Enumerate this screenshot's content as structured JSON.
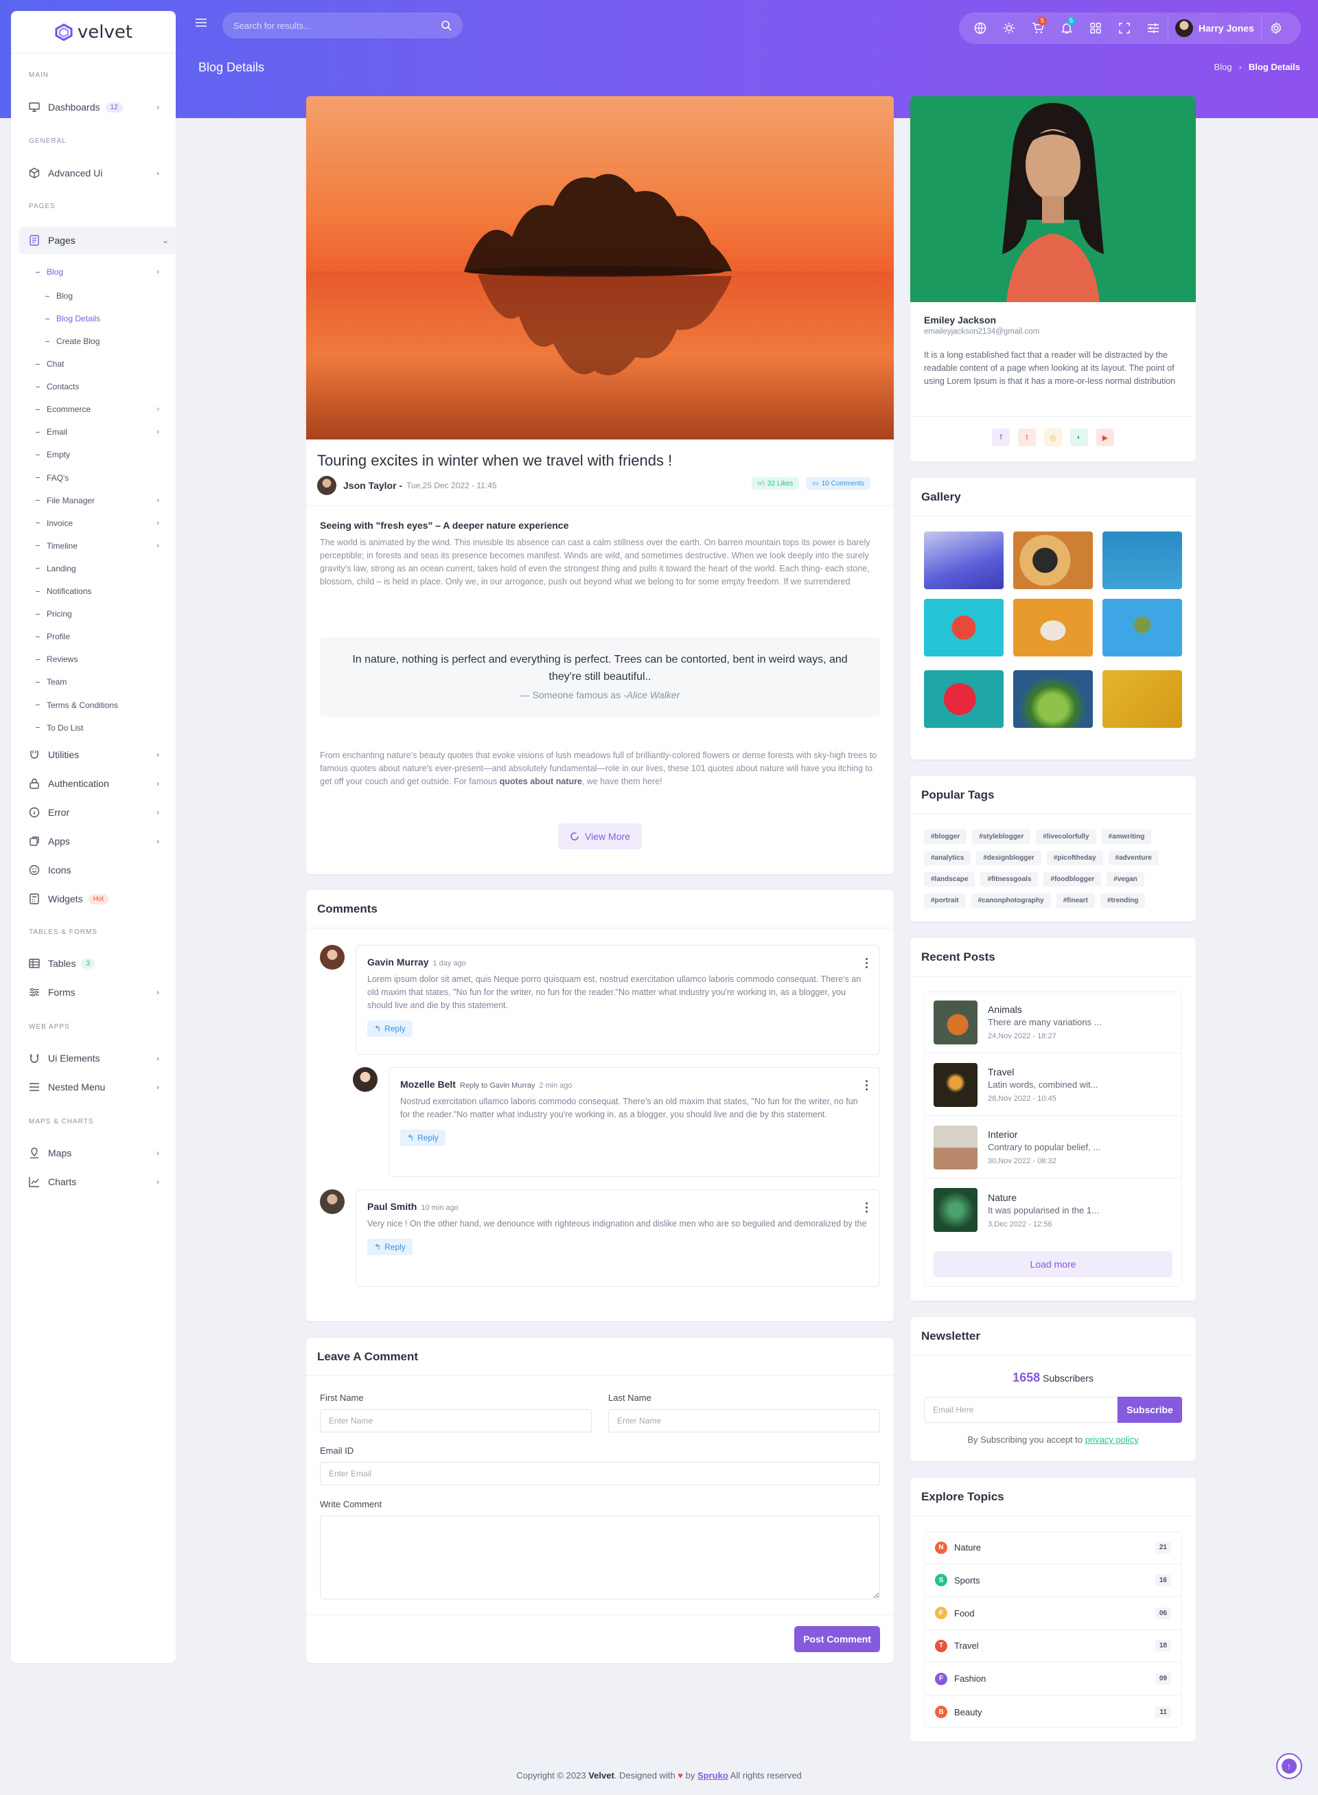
{
  "app": {
    "name": "velvet"
  },
  "topbar": {
    "search_placeholder": "Search for results...",
    "cart_count": "5",
    "notif_count": "5",
    "user_name": "Harry Jones"
  },
  "page": {
    "title": "Blog Details",
    "breadcrumb": [
      "Blog",
      "Blog Details"
    ]
  },
  "sidebar": {
    "cats": [
      "MAIN",
      "GENERAL",
      "PAGES",
      "TABLES & FORMS",
      "WEB APPS",
      "MAPS & CHARTS"
    ],
    "dashboards": {
      "label": "Dashboards",
      "badge": "12"
    },
    "advanced_ui": "Advanced Ui",
    "pages": "Pages",
    "blog": "Blog",
    "blog_sub": [
      "Blog",
      "Blog Details",
      "Create Blog"
    ],
    "pages_sub": [
      "Chat",
      "Contacts",
      "Ecommerce",
      "Email",
      "Empty",
      "FAQ's",
      "File Manager",
      "Invoice",
      "Timeline",
      "Landing",
      "Notifications",
      "Pricing",
      "Profile",
      "Reviews",
      "Team",
      "Terms & Conditions",
      "To Do List"
    ],
    "utilities": "Utilities",
    "authentication": "Authentication",
    "error": "Error",
    "apps": "Apps",
    "icons": "Icons",
    "widgets": {
      "label": "Widgets",
      "badge": "Hot"
    },
    "tables": {
      "label": "Tables",
      "badge": "3"
    },
    "forms": "Forms",
    "ui_elements": "Ui Elements",
    "nested_menu": "Nested Menu",
    "maps": "Maps",
    "charts": "Charts"
  },
  "post": {
    "title": "Touring excites in winter when we travel with friends !",
    "author": "Json Taylor -",
    "date": "Tue,25 Dec 2022 - 11:45",
    "likes": "32 Likes",
    "comments": "10 Comments",
    "subheading": "Seeing with \"fresh eyes\" – A deeper nature experience",
    "body1": "The world is animated by the wind. This invisible its absence can cast a calm stillness over the earth. On barren mountain tops its power is barely perceptible; in forests and seas its presence becomes manifest. Winds are wild, and sometimes destructive. When we look deeply into the surely gravity's law, strong as an ocean current, takes hold of even the strongest thing and pulls it toward the heart of the world. Each thing- each stone, blossom, child – is held in place. Only we, in our arrogance, push out beyond what we belong to for some empty freedom. If we surrendered",
    "quote": "In nature, nothing is perfect and everything is perfect. Trees can be contorted, bent in weird ways, and they're still beautiful..",
    "quote_source_prefix": "— Someone famous as",
    "quote_source": "-Alice Walker",
    "body2_a": "From enchanting nature's beauty quotes that evoke visions of lush meadows full of brilliantly-colored flowers or dense forests with sky-high trees to famous quotes about nature's ever-present—and absolutely fundamental—role in our lives, these 101 quotes about nature will have you itching to get off your couch and get outside. For famous",
    "body2_bold": "quotes about nature",
    "body2_b": ", we have them here!",
    "view_more": "View More"
  },
  "comments": {
    "title": "Comments",
    "items": [
      {
        "name": "Gavin Murray",
        "time": "1 day ago",
        "reply_to": "",
        "text": "Lorem ipsum dolor sit amet, quis Neque porro quisquam est, nostrud exercitation ullamco laboris commodo consequat. There's an old maxim that states, \"No fun for the writer, no fun for the reader.\"No matter what industry you're working in, as a blogger, you should live and die by this statement.",
        "reply": "Reply"
      },
      {
        "name": "Mozelle Belt",
        "time": "2 min ago",
        "reply_to": "Reply to Gavin Murray",
        "text": "Nostrud exercitation ullamco laboris commodo consequat. There's an old maxim that states, \"No fun for the writer, no fun for the reader.\"No matter what industry you're working in, as a blogger, you should live and die by this statement.",
        "reply": "Reply"
      },
      {
        "name": "Paul Smith",
        "time": "10 min ago",
        "reply_to": "",
        "text": "Very nice ! On the other hand, we denounce with righteous indignation and dislike men who are so beguiled and demoralized by the",
        "reply": "Reply"
      }
    ]
  },
  "form": {
    "title": "Leave A Comment",
    "first_name": "First Name",
    "last_name": "Last Name",
    "name_placeholder": "Enter Name",
    "email": "Email ID",
    "email_placeholder": "Enter Email",
    "comment": "Write Comment",
    "submit": "Post Comment"
  },
  "profile": {
    "name": "Emiley Jackson",
    "email": "emaileyjackson2134@gmail.com",
    "bio": "It is a long established fact that a reader will be distracted by the readable content of a page when looking at its layout. The point of using Lorem Ipsum is that it has a more-or-less normal distribution"
  },
  "gallery": {
    "title": "Gallery"
  },
  "tags": {
    "title": "Popular Tags",
    "items": [
      "#blogger",
      "#styleblogger",
      "#livecolorfully",
      "#amwriting",
      "#analytics",
      "#designblogger",
      "#picoftheday",
      "#adventure",
      "#landscape",
      "#fitnessgoals",
      "#foodblogger",
      "#vegan",
      "#portrait",
      "#canonphotography",
      "#fineart",
      "#trending"
    ]
  },
  "recent": {
    "title": "Recent Posts",
    "items": [
      {
        "title": "Animals",
        "desc": "There are many variations ...",
        "date": "24,Nov 2022 - 18:27"
      },
      {
        "title": "Travel",
        "desc": "Latin words, combined wit...",
        "date": "28,Nov 2022 - 10:45"
      },
      {
        "title": "Interior",
        "desc": "Contrary to popular belief, ...",
        "date": "30,Nov 2022 - 08:32"
      },
      {
        "title": "Nature",
        "desc": "It was popularised in the 1...",
        "date": "3,Dec 2022 - 12:56"
      }
    ],
    "load_more": "Load more"
  },
  "newsletter": {
    "title": "Newsletter",
    "count": "1658",
    "count_label": "Subscribers",
    "placeholder": "Email Here",
    "button": "Subscribe",
    "note": "By Subscribing you accept to",
    "link": "privacy policy"
  },
  "topics": {
    "title": "Explore Topics",
    "items": [
      {
        "letter": "N",
        "name": "Nature",
        "count": "21",
        "color": "#f0643c"
      },
      {
        "letter": "S",
        "name": "Sports",
        "count": "16",
        "color": "#26bf94"
      },
      {
        "letter": "F",
        "name": "Food",
        "count": "06",
        "color": "#f5b849"
      },
      {
        "letter": "T",
        "name": "Travel",
        "count": "18",
        "color": "#e6533c"
      },
      {
        "letter": "F",
        "name": "Fashion",
        "count": "09",
        "color": "#845adf"
      },
      {
        "letter": "B",
        "name": "Beauty",
        "count": "11",
        "color": "#f0643c"
      }
    ]
  },
  "footer": {
    "prefix": "Copyright © 2023",
    "brand": "Velvet",
    "mid": ". Designed with",
    "by": "by",
    "company": "Spruko",
    "suffix": "All rights reserved"
  },
  "colors": {
    "primary": "#845adf",
    "header_start": "#5a66f1",
    "header_end": "#8e52ee"
  }
}
